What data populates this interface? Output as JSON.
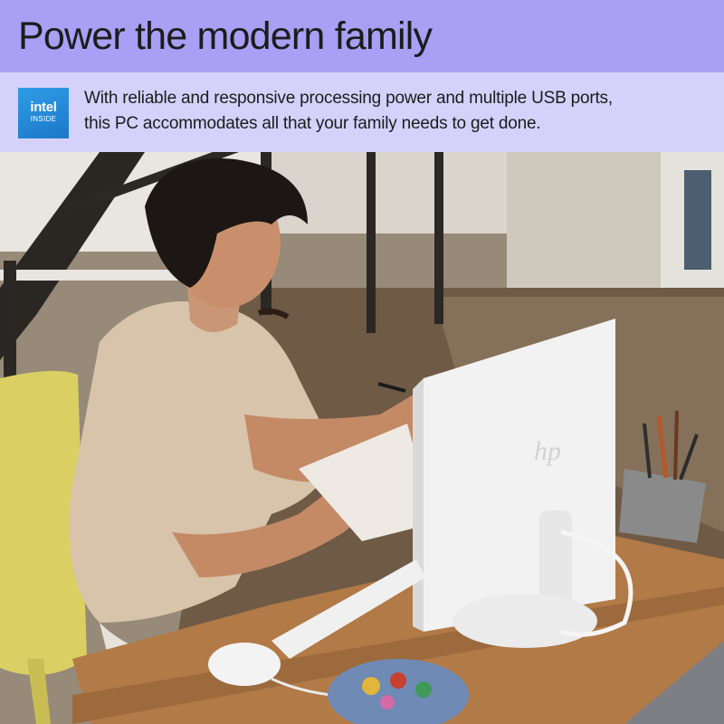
{
  "header": {
    "title": "Power the modern family"
  },
  "info": {
    "badge": {
      "brand": "intel",
      "sub": "INSIDE",
      "color": "#1f86d6"
    },
    "description_lines": [
      "With reliable and responsive processing power and multiple USB ports,",
      "this PC accommodates all that your family needs to get done."
    ]
  },
  "photo": {
    "monitor_logo": "hp"
  },
  "colors": {
    "title_band": "#ab9ef5",
    "info_band": "#d6d1fb",
    "text": "#1c1c1c"
  }
}
